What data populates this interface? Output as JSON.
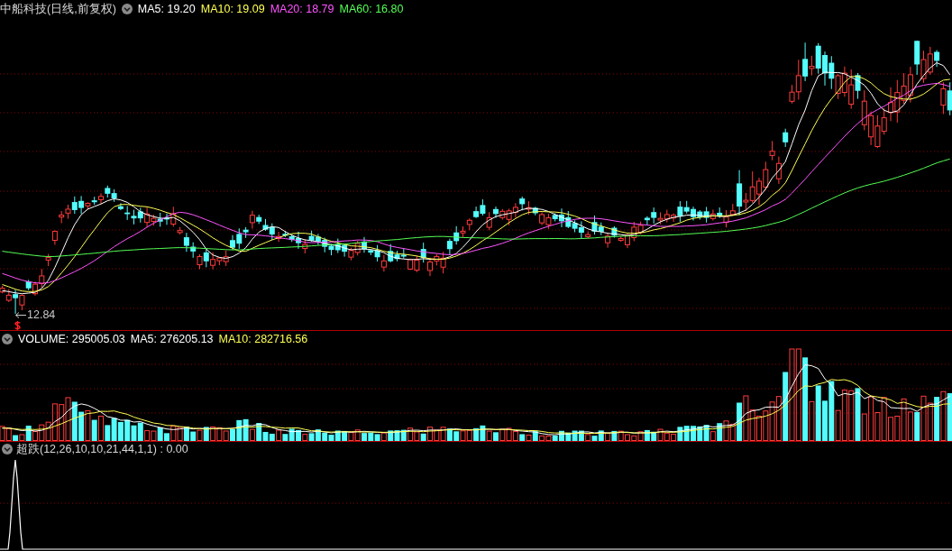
{
  "price_panel": {
    "title": "中船科技(日线,前复权)",
    "indicators": [
      {
        "label": "MA5: 19.20",
        "color": "#ffffff"
      },
      {
        "label": "MA10: 19.09",
        "color": "#ffff54"
      },
      {
        "label": "MA20: 18.79",
        "color": "#ff54ff"
      },
      {
        "label": "MA60: 16.80",
        "color": "#54ff54"
      }
    ],
    "low_marker": "12.84"
  },
  "volume_panel": {
    "indicators": [
      {
        "label": "VOLUME: 295005.03",
        "color": "#ffffff"
      },
      {
        "label": "MA5: 276205.13",
        "color": "#ffffff"
      },
      {
        "label": "MA10: 282716.56",
        "color": "#ffff54"
      }
    ]
  },
  "indicator_panel": {
    "label": "超跌(12,26,10,10,21,44,1,1) : 0.00"
  }
}
